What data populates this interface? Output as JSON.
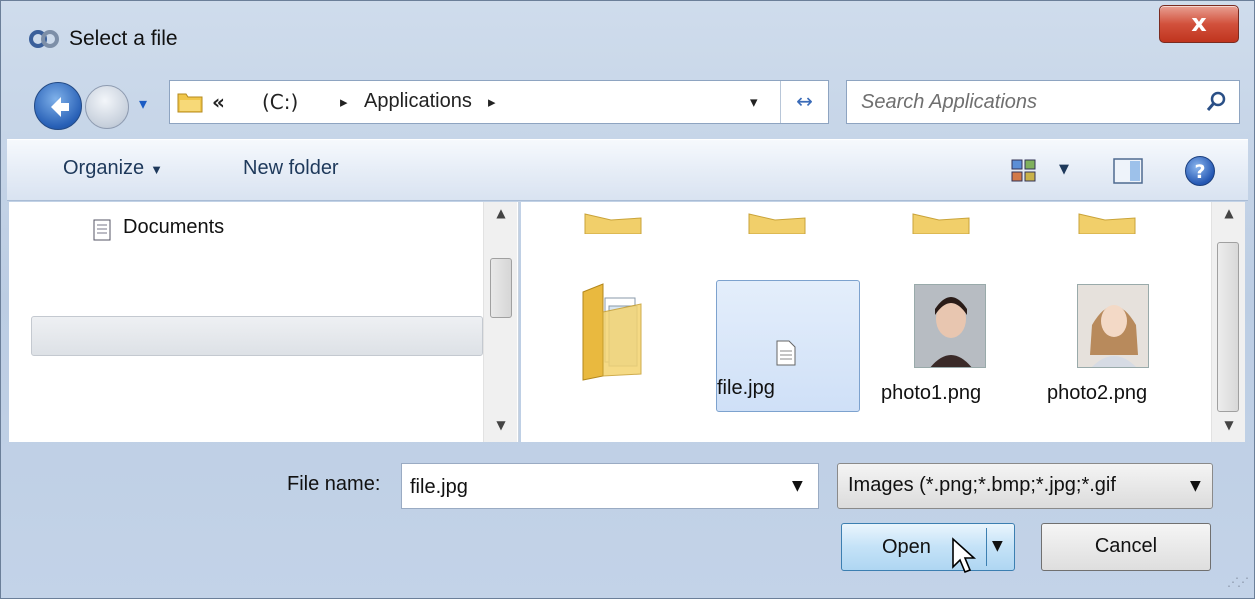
{
  "window": {
    "title": "Select a file",
    "close_label": "x"
  },
  "navigation": {
    "breadcrumb_overflow": "«",
    "breadcrumb_drive": "(C:)",
    "breadcrumb_separator": "▸",
    "breadcrumb_current": "Applications",
    "dropdown_arrow": "▾",
    "refresh_glyph": "↔"
  },
  "search": {
    "placeholder": "Search Applications"
  },
  "toolbar": {
    "organize_label": "Organize",
    "new_folder_label": "New folder",
    "caret": "▼",
    "help_label": "?"
  },
  "nav_pane": {
    "items": [
      {
        "label": "Documents",
        "icon": "document-library-icon"
      }
    ],
    "scroll_up": "▲",
    "scroll_down": "▼"
  },
  "files": {
    "items": [
      {
        "name": "file.jpg",
        "icon": "generic-file-icon",
        "selected": true
      },
      {
        "name": "photo1.png",
        "icon": "photo-thumbnail"
      },
      {
        "name": "photo2.png",
        "icon": "photo-thumbnail"
      }
    ]
  },
  "bottom": {
    "file_name_label": "File name:",
    "file_name_value": "file.jpg",
    "filter_value": "Images (*.png;*.bmp;*.jpg;*.gif",
    "open_label": "Open",
    "cancel_label": "Cancel",
    "dropdown_arrow": "▼"
  },
  "colors": {
    "chrome": "#c6d5ea",
    "selection": "#cfe0f7",
    "accent": "#2860b6",
    "close": "#c9432c"
  }
}
